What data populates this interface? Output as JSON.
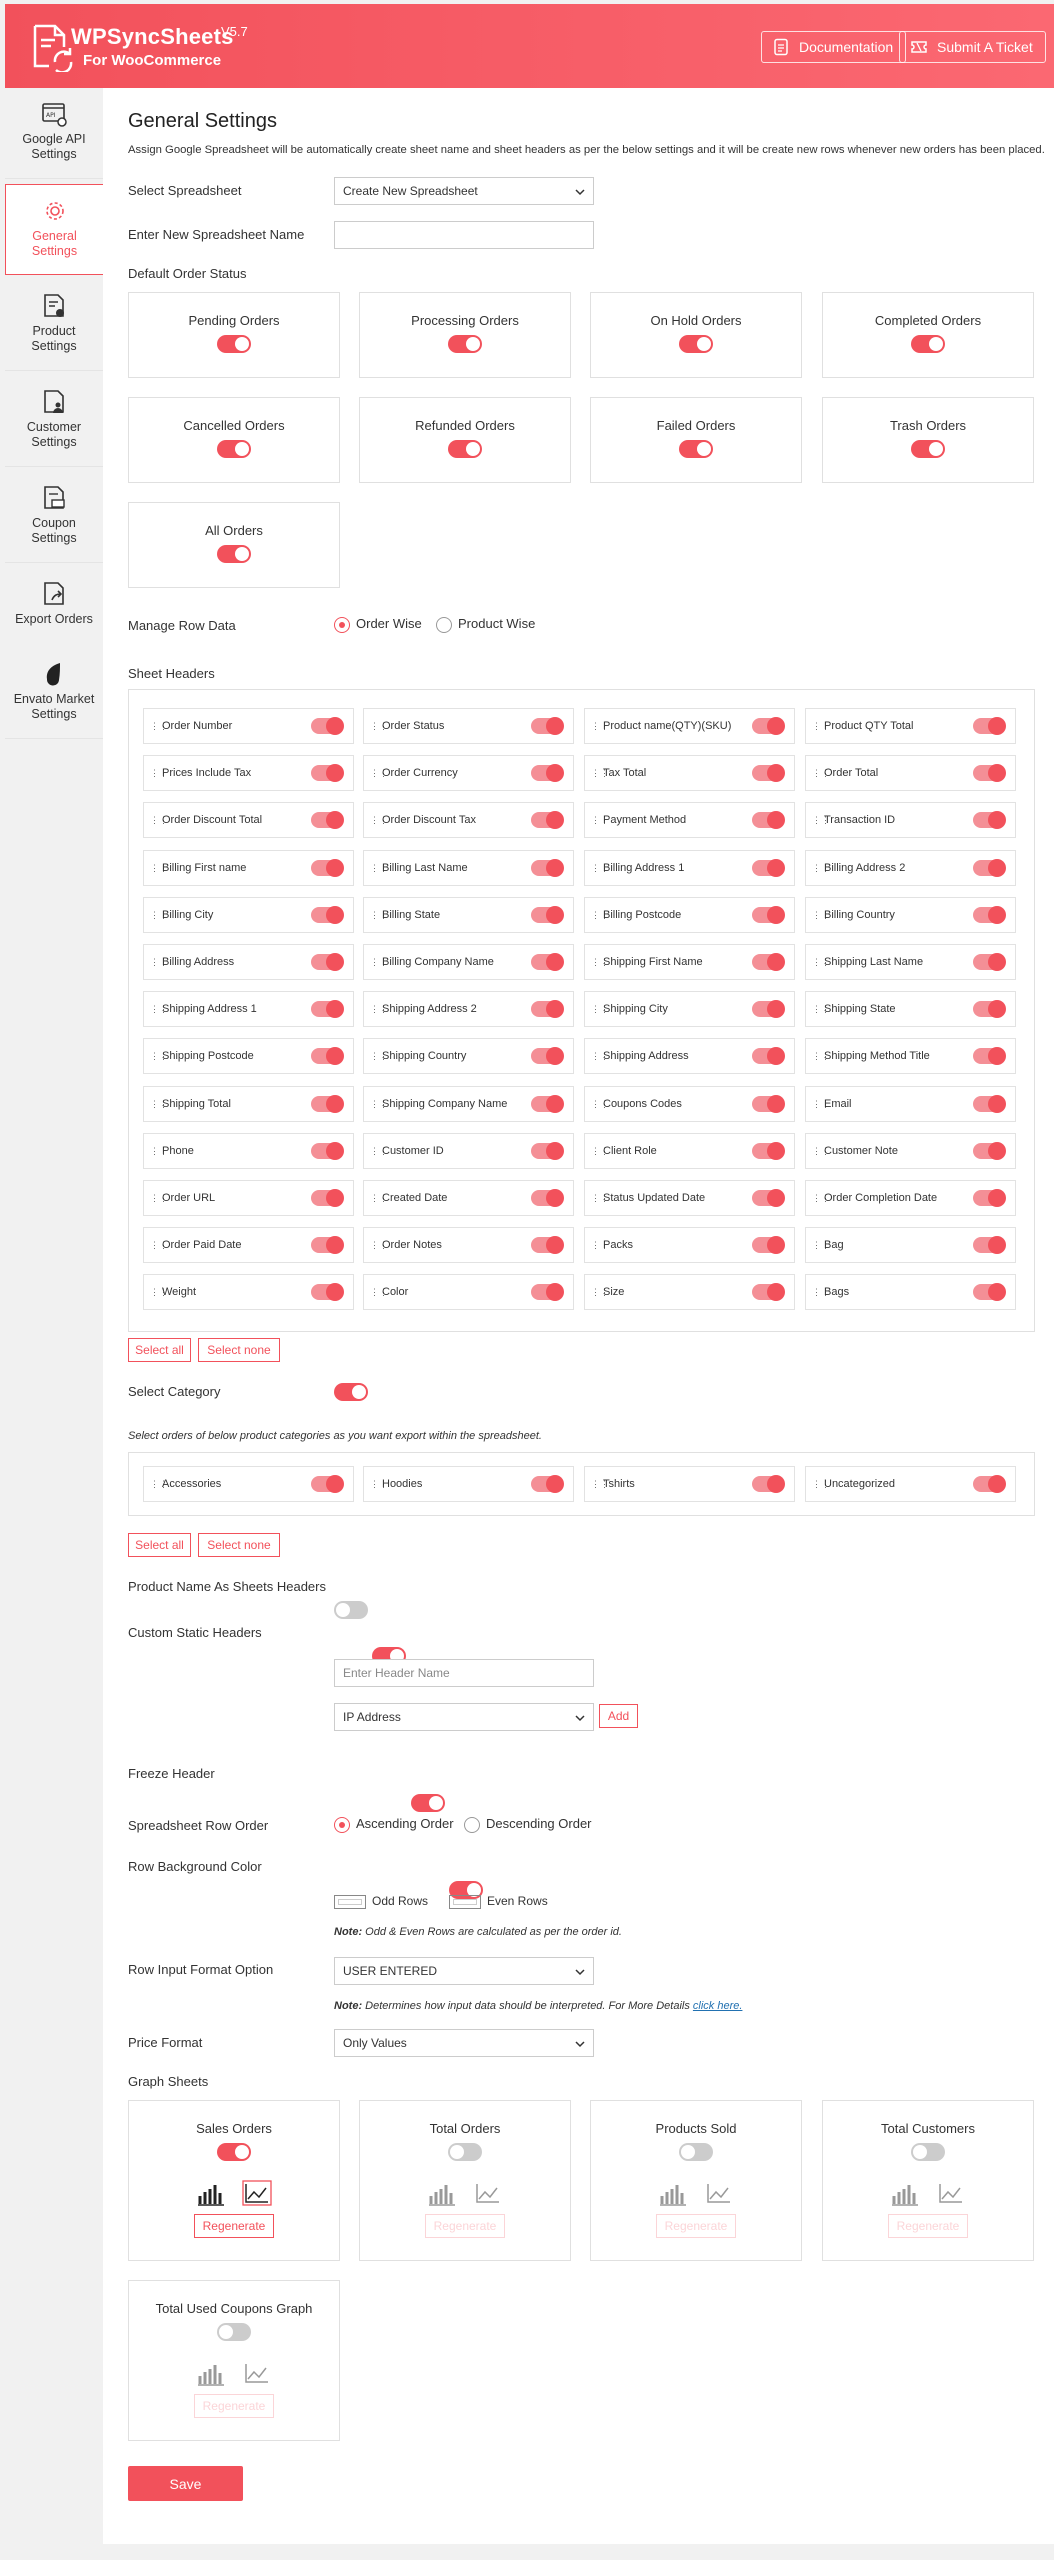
{
  "header": {
    "brand": "WPSyncSheets",
    "version": "V5.7",
    "subtitle": "For WooCommerce",
    "docs_label": "Documentation",
    "ticket_label": "Submit A Ticket"
  },
  "sidebar": {
    "items": [
      {
        "label": "Google API Settings"
      },
      {
        "label": "General Settings"
      },
      {
        "label": "Product Settings"
      },
      {
        "label": "Customer Settings"
      },
      {
        "label": "Coupon Settings"
      },
      {
        "label": "Export Orders"
      },
      {
        "label": "Envato Market Settings"
      }
    ]
  },
  "main": {
    "title": "General Settings",
    "description": "Assign Google Spreadsheet will be automatically create sheet name and sheet headers as per the below settings and it will be create new rows whenever new orders has been placed.",
    "select_spreadsheet_label": "Select Spreadsheet",
    "select_spreadsheet_value": "Create New Spreadsheet",
    "new_sheet_label": "Enter New Spreadsheet Name",
    "new_sheet_value": "",
    "order_status_label": "Default Order Status",
    "order_statuses": [
      {
        "label": "Pending Orders",
        "on": true
      },
      {
        "label": "Processing Orders",
        "on": true
      },
      {
        "label": "On Hold Orders",
        "on": true
      },
      {
        "label": "Completed Orders",
        "on": true
      },
      {
        "label": "Cancelled Orders",
        "on": true
      },
      {
        "label": "Refunded Orders",
        "on": true
      },
      {
        "label": "Failed Orders",
        "on": true
      },
      {
        "label": "Trash Orders",
        "on": true
      },
      {
        "label": "All Orders",
        "on": true
      }
    ],
    "manage_row_label": "Manage Row Data",
    "row_options": [
      "Order Wise",
      "Product Wise"
    ],
    "sheet_headers_label": "Sheet Headers",
    "headers": [
      "Order Number",
      "Order Status",
      "Product name(QTY)(SKU)",
      "Product QTY Total",
      "Prices Include Tax",
      "Order Currency",
      "Tax Total",
      "Order Total",
      "Order Discount Total",
      "Order Discount Tax",
      "Payment Method",
      "Transaction ID",
      "Billing First name",
      "Billing Last Name",
      "Billing Address 1",
      "Billing Address 2",
      "Billing City",
      "Billing State",
      "Billing Postcode",
      "Billing Country",
      "Billing Address",
      "Billing Company Name",
      "Shipping First Name",
      "Shipping Last Name",
      "Shipping Address 1",
      "Shipping Address 2",
      "Shipping City",
      "Shipping State",
      "Shipping Postcode",
      "Shipping Country",
      "Shipping Address",
      "Shipping Method Title",
      "Shipping Total",
      "Shipping Company Name",
      "Coupons Codes",
      "Email",
      "Phone",
      "Customer ID",
      "Client Role",
      "Customer Note",
      "Order URL",
      "Created Date",
      "Status Updated Date",
      "Order Completion Date",
      "Order Paid Date",
      "Order Notes",
      "Packs",
      "Bag",
      "Weight",
      "Color",
      "Size",
      "Bags"
    ],
    "select_all": "Select all",
    "select_none": "Select none",
    "select_category_label": "Select Category",
    "category_note": "Select orders of below product categories as you want export within the spreadsheet.",
    "categories": [
      "Accessories",
      "Hoodies",
      "Tshirts",
      "Uncategorized"
    ],
    "product_name_headers_label": "Product Name As Sheets Headers",
    "custom_static_headers_label": "Custom Static Headers",
    "header_name_placeholder": "Enter Header Name",
    "custom_header_select": "IP Address",
    "add_label": "Add",
    "freeze_header_label": "Freeze Header",
    "row_order_label": "Spreadsheet Row Order",
    "row_order_options": [
      "Ascending Order",
      "Descending Order"
    ],
    "row_bg_label": "Row Background Color",
    "odd_rows": "Odd Rows",
    "even_rows": "Even Rows",
    "note_word": "Note:",
    "bg_note": "Odd & Even Rows are calculated as per the order id.",
    "input_format_label": "Row Input Format Option",
    "input_format_value": "USER ENTERED",
    "input_format_note": "Determines how input data should be interpreted. For More Details",
    "click_here": "click here.",
    "price_format_label": "Price Format",
    "price_format_value": "Only Values",
    "graph_sheets_label": "Graph Sheets",
    "graphs": [
      {
        "label": "Sales Orders",
        "on": true
      },
      {
        "label": "Total Orders",
        "on": false
      },
      {
        "label": "Products Sold",
        "on": false
      },
      {
        "label": "Total Customers",
        "on": false
      },
      {
        "label": "Total Used Coupons Graph",
        "on": false
      }
    ],
    "regenerate": "Regenerate",
    "save_label": "Save"
  },
  "colors": {
    "accent": "#f2515b",
    "accent_light": "#f48f96",
    "disabled": "#fbd5d8"
  }
}
